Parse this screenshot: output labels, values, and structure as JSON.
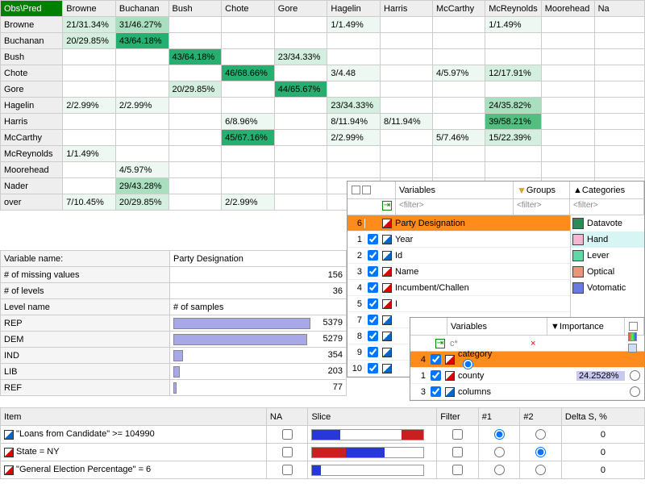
{
  "cm": {
    "corner": "Obs\\Pred",
    "cols": [
      "Browne",
      "Buchanan",
      "Bush",
      "Chote",
      "Gore",
      "Hagelin",
      "Harris",
      "McCarthy",
      "McReynolds",
      "Moorehead",
      "Na"
    ],
    "rows": [
      {
        "h": "Browne",
        "c": [
          "21/31.34%",
          "31/46.27%",
          "",
          "",
          "",
          "1/1.49%",
          "",
          "",
          "1/1.49%",
          "",
          ""
        ]
      },
      {
        "h": "Buchanan",
        "c": [
          "20/29.85%",
          "43/64.18%",
          "",
          "",
          "",
          "",
          "",
          "",
          "",
          "",
          ""
        ]
      },
      {
        "h": "Bush",
        "c": [
          "",
          "",
          "43/64.18%",
          "",
          "23/34.33%",
          "",
          "",
          "",
          "",
          "",
          ""
        ]
      },
      {
        "h": "Chote",
        "c": [
          "",
          "",
          "",
          "46/68.66%",
          "",
          "3/4.48",
          "",
          "4/5.97%",
          "12/17.91%",
          "",
          ""
        ]
      },
      {
        "h": "Gore",
        "c": [
          "",
          "",
          "20/29.85%",
          "",
          "44/65.67%",
          "",
          "",
          "",
          "",
          "",
          ""
        ]
      },
      {
        "h": "Hagelin",
        "c": [
          "2/2.99%",
          "2/2.99%",
          "",
          "",
          "",
          "23/34.33%",
          "",
          "",
          "24/35.82%",
          "",
          ""
        ]
      },
      {
        "h": "Harris",
        "c": [
          "",
          "",
          "",
          "6/8.96%",
          "",
          "8/11.94%",
          "8/11.94%",
          "",
          "39/58.21%",
          "",
          ""
        ]
      },
      {
        "h": "McCarthy",
        "c": [
          "",
          "",
          "",
          "45/67.16%",
          "",
          "2/2.99%",
          "",
          "5/7.46%",
          "15/22.39%",
          "",
          ""
        ]
      },
      {
        "h": "McReynolds",
        "c": [
          "1/1.49%",
          "",
          "",
          "",
          "",
          "",
          "",
          "",
          "",
          "",
          ""
        ]
      },
      {
        "h": "Moorehead",
        "c": [
          "",
          "4/5.97%",
          "",
          "",
          "",
          "",
          "",
          "",
          "",
          "",
          ""
        ]
      },
      {
        "h": "Nader",
        "c": [
          "",
          "29/43.28%",
          "",
          "",
          "",
          "",
          "",
          "",
          "",
          "",
          ""
        ]
      },
      {
        "h": "over",
        "c": [
          "7/10.45%",
          "20/29.85%",
          "",
          "2/2.99%",
          "",
          "",
          "",
          "",
          "",
          "",
          ""
        ]
      }
    ],
    "shades": {
      "0-0": 2,
      "0-1": 3,
      "0-5": 1,
      "0-8": 1,
      "1-0": 2,
      "1-1": 5,
      "2-2": 5,
      "2-4": 2,
      "3-3": 5,
      "3-5": 1,
      "3-7": 1,
      "3-8": 2,
      "4-2": 2,
      "4-4": 5,
      "5-0": 1,
      "5-1": 1,
      "5-5": 2,
      "5-8": 3,
      "6-3": 1,
      "6-5": 1,
      "6-6": 1,
      "6-8": 4,
      "7-3": 5,
      "7-5": 1,
      "7-7": 1,
      "7-8": 2,
      "8-0": 1,
      "9-1": 1,
      "10-1": 3,
      "11-0": 1,
      "11-1": 2,
      "11-3": 1
    }
  },
  "varinfo": {
    "name_lab": "Variable name:",
    "name_val": "Party Designation",
    "miss_lab": "# of missing values",
    "miss_val": "156",
    "lev_lab": "# of levels",
    "lev_val": "36",
    "level_hdr": "Level name",
    "samples_hdr": "# of samples",
    "levels": [
      {
        "n": "REP",
        "v": "5379",
        "w": 170
      },
      {
        "n": "DEM",
        "v": "5279",
        "w": 166
      },
      {
        "n": "IND",
        "v": "354",
        "w": 12
      },
      {
        "n": "LIB",
        "v": "203",
        "w": 8
      },
      {
        "n": "REF",
        "v": "77",
        "w": 4
      }
    ]
  },
  "varpanel": {
    "variables_hdr": "Variables",
    "groups_hdr": "Groups",
    "categories_hdr": "Categories",
    "filter_ph": "<filter>",
    "sel_num": "6",
    "sel_name": "Party Designation",
    "rows": [
      {
        "n": "1",
        "ico": "blue",
        "name": "Year"
      },
      {
        "n": "2",
        "ico": "blue",
        "name": "Id"
      },
      {
        "n": "3",
        "ico": "red",
        "name": "Name"
      },
      {
        "n": "4",
        "ico": "red",
        "name": "Incumbent/Challen"
      },
      {
        "n": "5",
        "ico": "red",
        "name": "I"
      },
      {
        "n": "7",
        "ico": "blue",
        "name": ""
      },
      {
        "n": "8",
        "ico": "blue",
        "name": ""
      },
      {
        "n": "9",
        "ico": "blue",
        "name": ""
      },
      {
        "n": "10",
        "ico": "blue",
        "name": ""
      }
    ],
    "cats": [
      {
        "c": "#2e8b57",
        "n": "Datavote"
      },
      {
        "c": "#f7b6d2",
        "n": "Hand"
      },
      {
        "c": "#5fd7a7",
        "n": "Lever"
      },
      {
        "c": "#e9967a",
        "n": "Optical"
      },
      {
        "c": "#6a7ae0",
        "n": "Votomatic"
      }
    ]
  },
  "subvar": {
    "variables_hdr": "Variables",
    "importance_hdr": "Importance",
    "filter_ph": "c*",
    "x": "×",
    "rows": [
      {
        "n": "4",
        "ico": "red",
        "name": "category <F",
        "imp": "",
        "sel": true
      },
      {
        "n": "1",
        "ico": "red",
        "name": "county",
        "imp": "24.2528%"
      },
      {
        "n": "3",
        "ico": "blue",
        "name": "columns",
        "imp": ""
      }
    ]
  },
  "items": {
    "cols": [
      "Item",
      "NA",
      "Slice",
      "Filter",
      "#1",
      "#2",
      "Delta S, %"
    ],
    "rows": [
      {
        "ico": "blue",
        "item": "\"Loans from Candidate\" >= 104990",
        "na": false,
        "slice": {
          "blue": [
            0,
            25
          ],
          "red": [
            80,
            20
          ]
        },
        "r1": true,
        "r2": false,
        "d": "0"
      },
      {
        "ico": "red",
        "item": "State = NY",
        "na": false,
        "slice": {
          "red": [
            0,
            30
          ],
          "blue": [
            30,
            35
          ]
        },
        "r1": false,
        "r2": true,
        "d": "0"
      },
      {
        "ico": "red",
        "item": "\"General Election Percentage\" = 6",
        "na": false,
        "slice": {
          "blue": [
            0,
            8
          ]
        },
        "r1": false,
        "r2": false,
        "d": "0"
      }
    ]
  }
}
